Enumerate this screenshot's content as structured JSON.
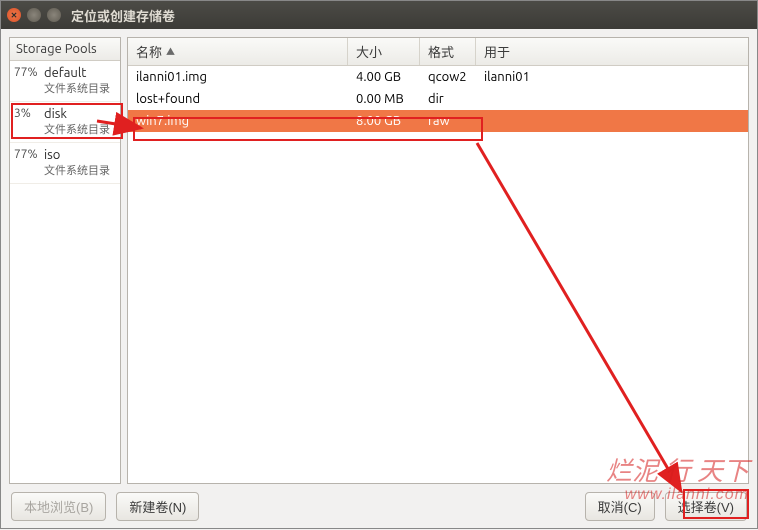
{
  "window": {
    "title": "定位或创建存储卷"
  },
  "sidebar": {
    "header": "Storage Pools",
    "pools": [
      {
        "percent": "77%",
        "name": "default",
        "sub": "文件系统目录"
      },
      {
        "percent": "3%",
        "name": "disk",
        "sub": "文件系统目录"
      },
      {
        "percent": "77%",
        "name": "iso",
        "sub": "文件系统目录"
      }
    ]
  },
  "table": {
    "columns": {
      "name": "名称",
      "size": "大小",
      "format": "格式",
      "used": "用于"
    },
    "rows": [
      {
        "name": "ilanni01.img",
        "size": "4.00 GB",
        "format": "qcow2",
        "used": "ilanni01",
        "selected": false
      },
      {
        "name": "lost+found",
        "size": "0.00 MB",
        "format": "dir",
        "used": "",
        "selected": false
      },
      {
        "name": "win7.img",
        "size": "8.00 GB",
        "format": "raw",
        "used": "",
        "selected": true
      }
    ]
  },
  "buttons": {
    "browse_local": "本地浏览(B)",
    "new_volume": "新建卷(N)",
    "cancel": "取消(C)",
    "select_volume": "选择卷(V)"
  },
  "annotations": {
    "watermark_line1": "烂泥 行 天下",
    "watermark_line2": "www.ilanni.com"
  }
}
